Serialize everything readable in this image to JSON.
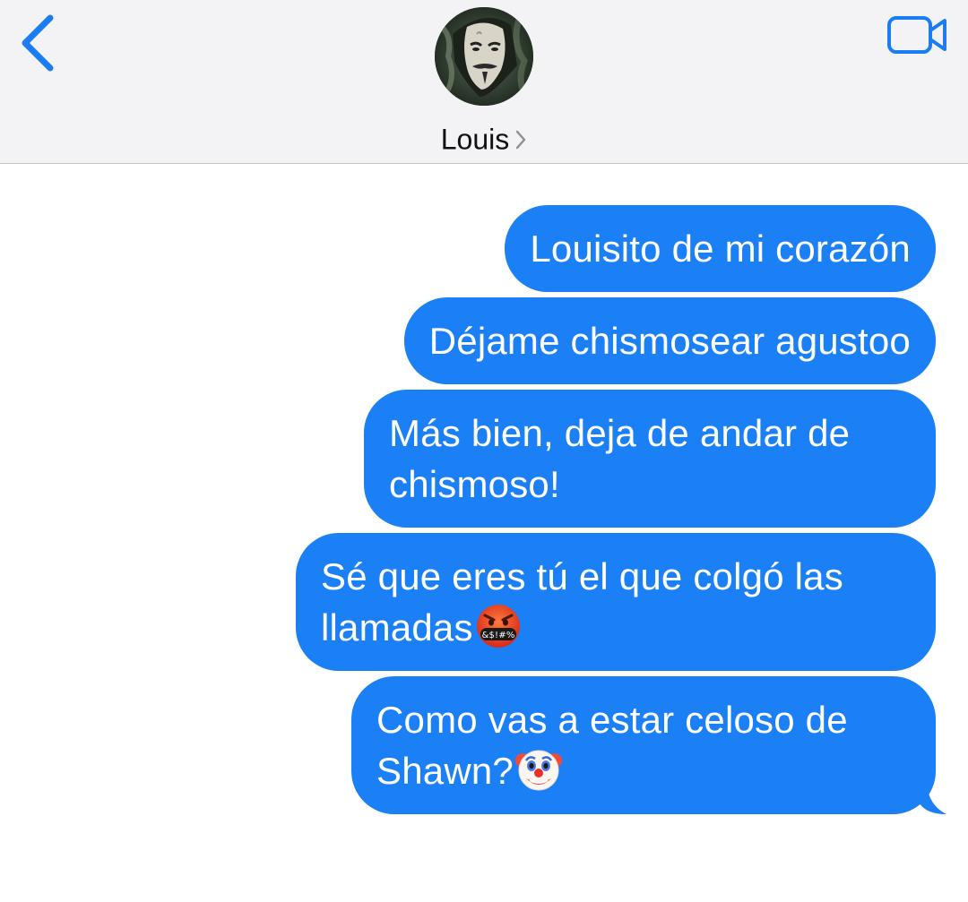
{
  "header": {
    "contact_name": "Louis",
    "back_icon": "chevron-left-icon",
    "video_icon": "video-camera-icon",
    "accent_color": "#1c7cf4"
  },
  "messages": [
    {
      "text": "Louisito de mi corazón",
      "emoji": null
    },
    {
      "text": "Déjame chismosear agustoo",
      "emoji": null
    },
    {
      "text": "Más bien, deja de andar de chismoso!",
      "emoji": null
    },
    {
      "text": "Sé que eres tú el que colgó las llamadas",
      "emoji": "face-with-symbols-on-mouth-emoji",
      "emoji_text": "&$!#%"
    },
    {
      "text": "Como vas a estar celoso de Shawn?",
      "emoji": "clown-face-emoji"
    }
  ],
  "colors": {
    "bubble": "#1b80f5",
    "header_bg": "#f3f3f6"
  }
}
